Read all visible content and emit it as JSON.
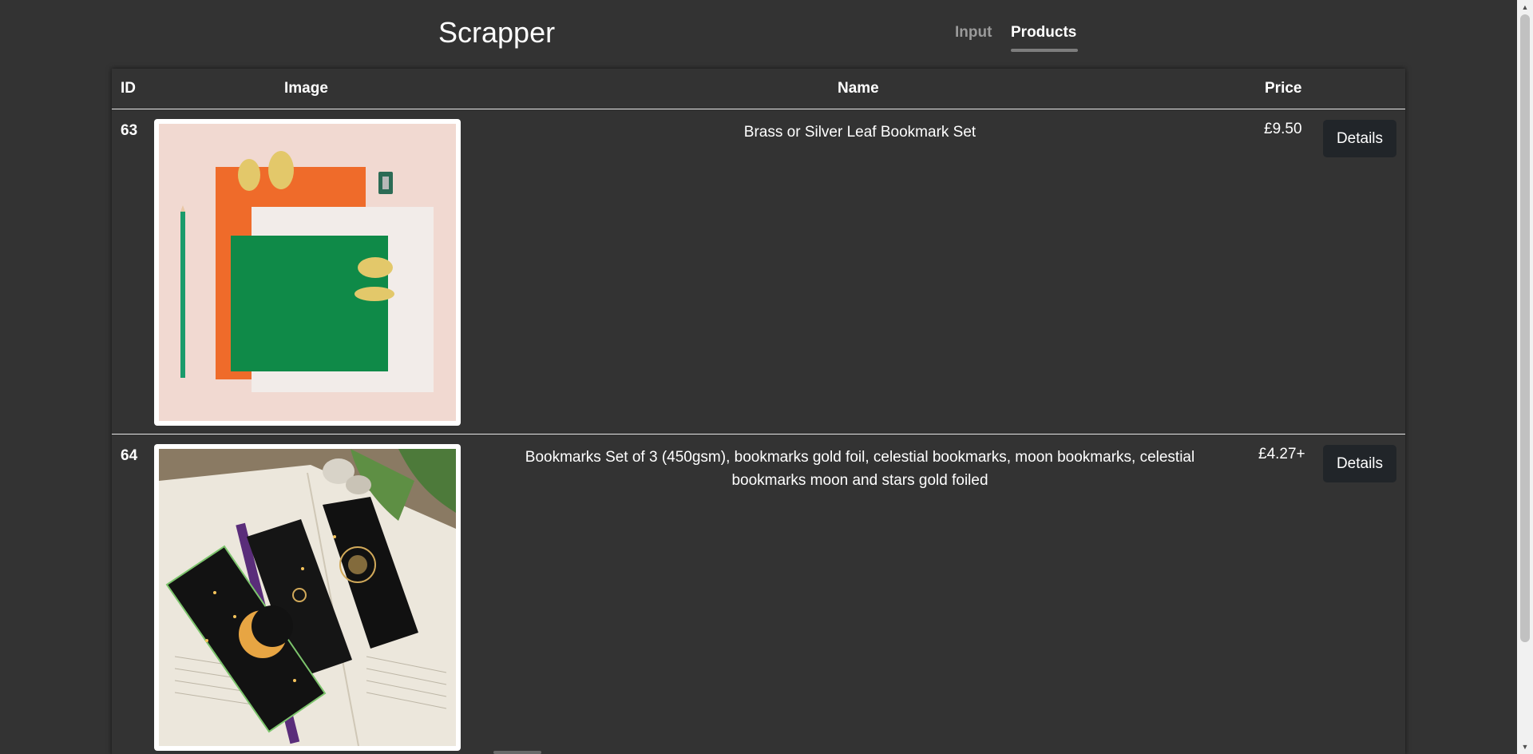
{
  "app": {
    "title": "Scrapper"
  },
  "nav": {
    "tabs": [
      {
        "label": "Input",
        "active": false
      },
      {
        "label": "Products",
        "active": true
      }
    ]
  },
  "table": {
    "headers": {
      "id": "ID",
      "image": "Image",
      "name": "Name",
      "price": "Price"
    },
    "rows": [
      {
        "id": "63",
        "name": "Brass or Silver Leaf Bookmark Set",
        "price": "£9.50",
        "action": "Details",
        "image_icon": "product-photo-leaf-bookmarks"
      },
      {
        "id": "64",
        "name": "Bookmarks Set of 3 (450gsm), bookmarks gold foil, celestial bookmarks, moon bookmarks, celestial bookmarks moon and stars gold foiled",
        "price": "£4.27+",
        "action": "Details",
        "image_icon": "product-photo-celestial-bookmarks"
      }
    ]
  },
  "colors": {
    "background": "#333333",
    "button": "#212529",
    "active_tab": "#ffffff",
    "inactive_tab": "#9a9a9a"
  }
}
